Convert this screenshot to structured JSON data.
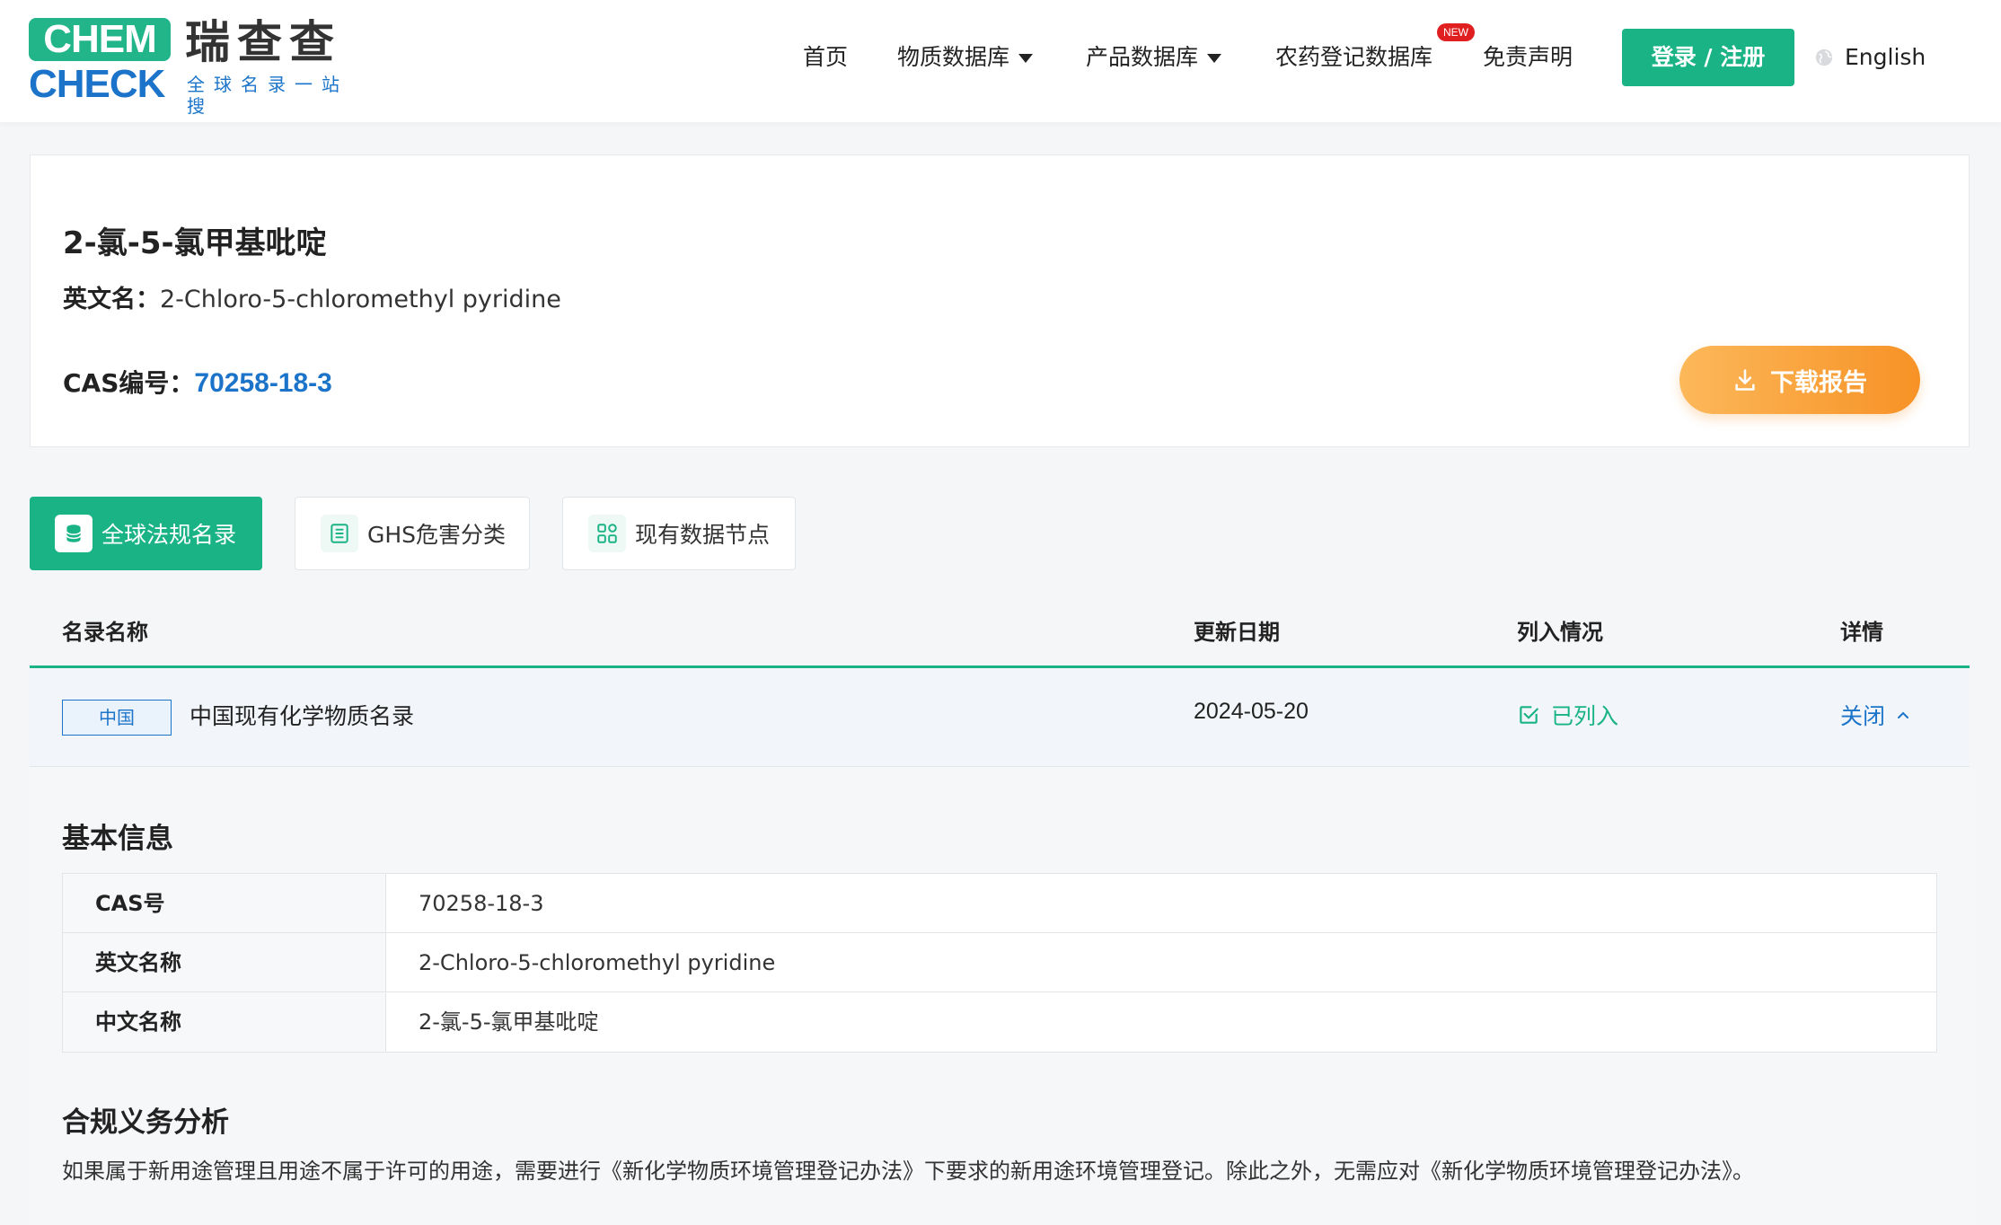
{
  "header": {
    "logo": {
      "chem": "CHEM",
      "check": "CHECK",
      "cn": "瑞查查",
      "slogan": "全球名录一站搜"
    },
    "nav": [
      {
        "label": "首页",
        "has_dropdown": false
      },
      {
        "label": "物质数据库",
        "has_dropdown": true
      },
      {
        "label": "产品数据库",
        "has_dropdown": true
      },
      {
        "label": "农药登记数据库",
        "has_dropdown": false,
        "badge": "NEW"
      },
      {
        "label": "免责声明",
        "has_dropdown": false
      }
    ],
    "login_label": "登录 / 注册",
    "language_label": "English"
  },
  "substance": {
    "title": "2-氯-5-氯甲基吡啶",
    "en_label": "英文名：",
    "en_name": "2-Chloro-5-chloromethyl pyridine",
    "cas_label": "CAS编号：",
    "cas": "70258-18-3",
    "download_label": "下载报告"
  },
  "tabs": [
    {
      "label": "全球法规名录",
      "active": true,
      "icon": "database-icon"
    },
    {
      "label": "GHS危害分类",
      "active": false,
      "icon": "list-icon"
    },
    {
      "label": "现有数据节点",
      "active": false,
      "icon": "grid-icon"
    }
  ],
  "table": {
    "headers": {
      "name": "名录名称",
      "date": "更新日期",
      "status": "列入情况",
      "detail": "详情"
    },
    "rows": [
      {
        "country": "中国",
        "name": "中国现有化学物质名录",
        "date": "2024-05-20",
        "status": "已列入",
        "action": "关闭"
      }
    ]
  },
  "detail": {
    "basic_title": "基本信息",
    "basic_info": [
      {
        "key": "CAS号",
        "value": "70258-18-3"
      },
      {
        "key": "英文名称",
        "value": "2-Chloro-5-chloromethyl pyridine"
      },
      {
        "key": "中文名称",
        "value": "2-氯-5-氯甲基吡啶"
      }
    ],
    "compliance_title": "合规义务分析",
    "compliance_text": "如果属于新用途管理且用途不属于许可的用途，需要进行《新化学物质环境管理登记办法》下要求的新用途环境管理登记。除此之外，无需应对《新化学物质环境管理登记办法》。"
  },
  "colors": {
    "brand_green": "#1ab385",
    "brand_blue": "#1b74c9",
    "accent_orange": "#f79226",
    "new_badge": "#e02020"
  }
}
